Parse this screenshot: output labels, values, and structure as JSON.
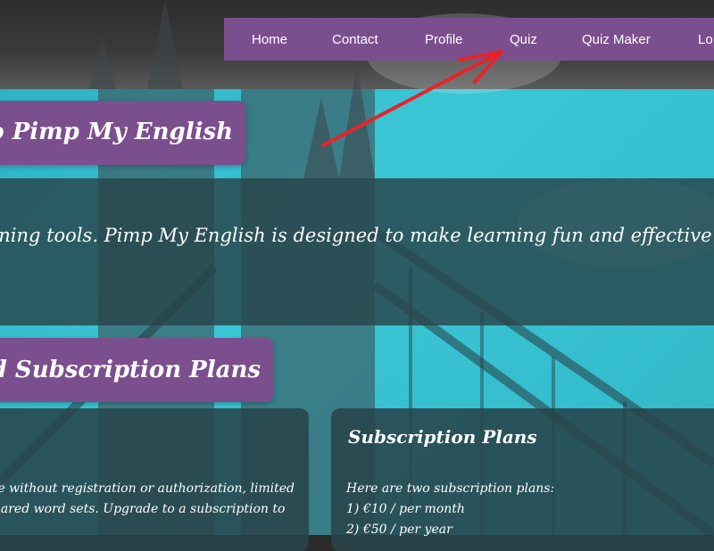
{
  "nav": {
    "items": [
      {
        "label": "Home"
      },
      {
        "label": "Contact"
      },
      {
        "label": "Profile"
      },
      {
        "label": "Quiz"
      },
      {
        "label": "Quiz Maker"
      },
      {
        "label": "Lo"
      }
    ]
  },
  "hero": {
    "welcome_title": "me to Pimp My English",
    "intro_text": "zed learning tools. Pimp My English is designed to make learning fun and effective f"
  },
  "plans_section": {
    "title": "es and Subscription Plans"
  },
  "left_card": {
    "lines": [
      "ervice without registration or authorization, limited",
      "nd shared word sets. Upgrade to a subscription to"
    ]
  },
  "right_card": {
    "title": "Subscription Plans",
    "lines": [
      "Here are two subscription plans:",
      "1) €10 / per month",
      "2) €50 / per year"
    ]
  },
  "annotation": {
    "color": "#e8232a",
    "target": "nav quiz link"
  },
  "colors": {
    "nav_bg": "#7b4f8e",
    "teal": "#3bc6d6",
    "panel": "#28444a"
  }
}
